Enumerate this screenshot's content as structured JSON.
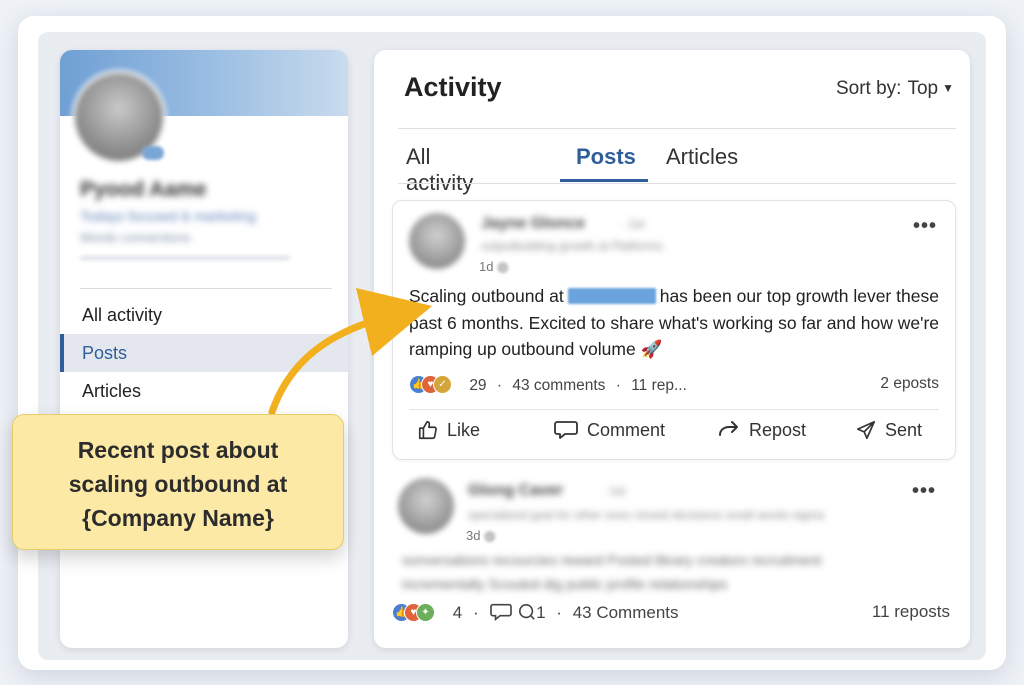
{
  "profile": {
    "name": "Pyood Aame",
    "headline": "Todays focused & marketing",
    "subline": "Words connections",
    "nav": [
      {
        "label": "All activity",
        "active": false
      },
      {
        "label": "Posts",
        "active": true
      },
      {
        "label": "Articles",
        "active": false
      }
    ]
  },
  "activity": {
    "title": "Activity",
    "sort_label": "Sort by:",
    "sort_value": "Top",
    "tabs": [
      {
        "label": "All activity",
        "active": false
      },
      {
        "label": "Posts",
        "active": true
      },
      {
        "label": "Articles",
        "active": false
      }
    ]
  },
  "post1": {
    "author": "Jayne Glonce",
    "degree": "· 1st",
    "author_headline": "outputbuilding growth at Platforms",
    "time": "1d",
    "text_before": "Scaling outbound at",
    "text_after": "has been our top growth lever these past 6 months. Excited to share what's working so far and how we're ramping up outbound volume",
    "emoji": "🚀",
    "reaction_count": "29",
    "comments": "43 comments",
    "reposts_short": "11 rep...",
    "reposts_right": "2 eposts",
    "actions": {
      "like": "Like",
      "comment": "Comment",
      "repost": "Repost",
      "send": "Sent"
    }
  },
  "post2": {
    "author": "Glong Caver",
    "degree": "· 1st",
    "author_headline": "specialized goal for other ones closed decisions small words sigma",
    "time": "3d",
    "blur_line": "sonversations recourcies reward Posted library creators recruitment",
    "blur_line2": "incrementally Scouted dig public profile relationships",
    "reaction_count": "4",
    "comment_count": "1",
    "comments": "43 Comments",
    "reposts": "11 reposts"
  },
  "callout": {
    "line1": "Recent post about",
    "line2": "scaling outbound at",
    "line3": "{Company Name}"
  },
  "colors": {
    "accent": "#2f5f9a",
    "callout_bg": "#fce9a6",
    "arrow": "#f2b01e"
  },
  "icons": [
    "more-icon",
    "like-icon",
    "comment-icon",
    "repost-icon",
    "send-icon",
    "caret-down-icon",
    "rocket-icon"
  ]
}
